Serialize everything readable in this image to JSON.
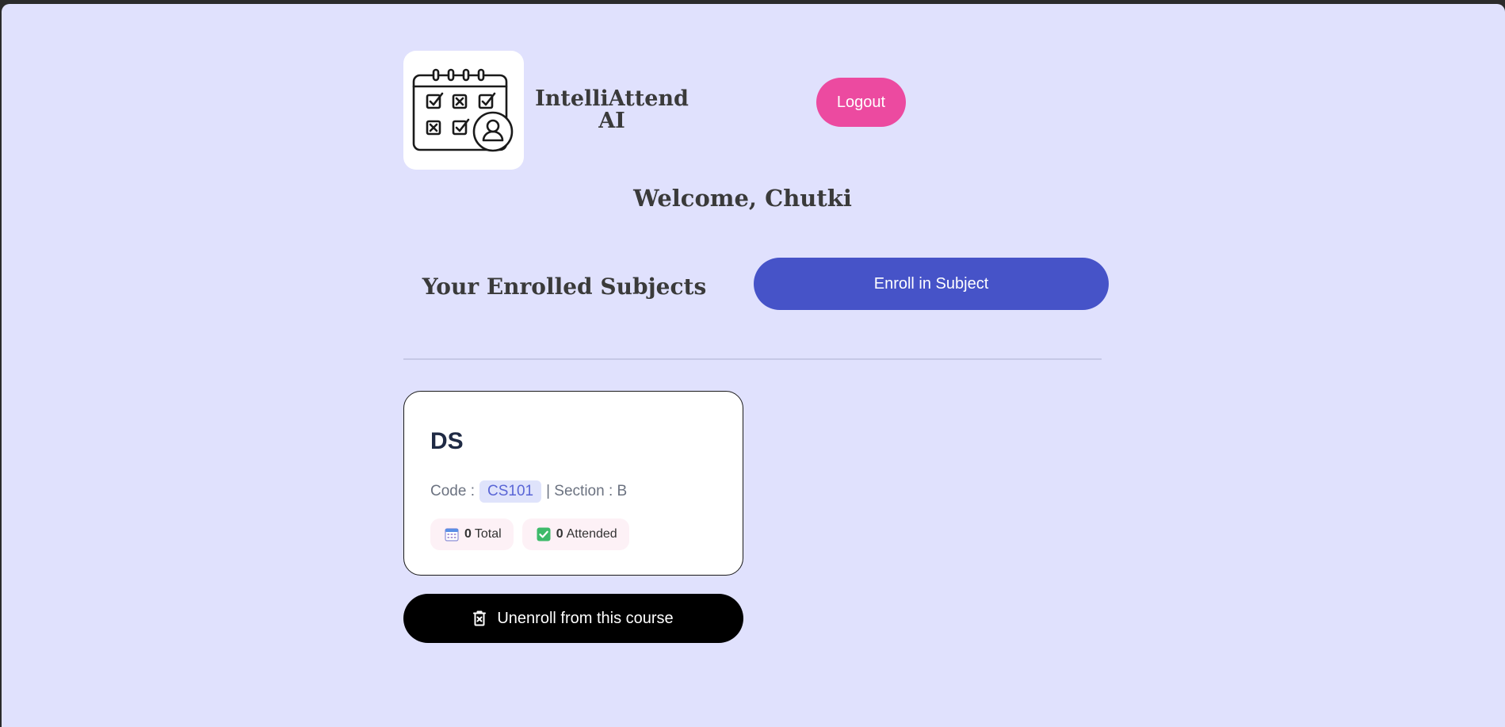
{
  "header": {
    "brand_name": "IntelliAttend AI",
    "logout_label": "Logout",
    "logo_icon": "calendar-attendance-icon"
  },
  "welcome": {
    "text": "Welcome, Chutki"
  },
  "subjects": {
    "title": "Your Enrolled Subjects",
    "enroll_label": "Enroll in Subject",
    "items": [
      {
        "name": "DS",
        "code_label": "Code :",
        "code": "CS101",
        "section_text": "| Section : B",
        "total_count": "0",
        "total_label": "Total",
        "total_icon": "calendar-icon",
        "attended_count": "0",
        "attended_label": "Attended",
        "attended_icon": "check-box-icon",
        "unenroll_label": "Unenroll from this course",
        "unenroll_icon": "trash-icon"
      }
    ]
  },
  "colors": {
    "page_background": "#e0e1fd",
    "logout_button": "#ec4aa0",
    "enroll_button": "#4653c8",
    "unenroll_button": "#000000",
    "code_chip": "#dfe3fb",
    "stat_chip": "#fdf1f6"
  }
}
